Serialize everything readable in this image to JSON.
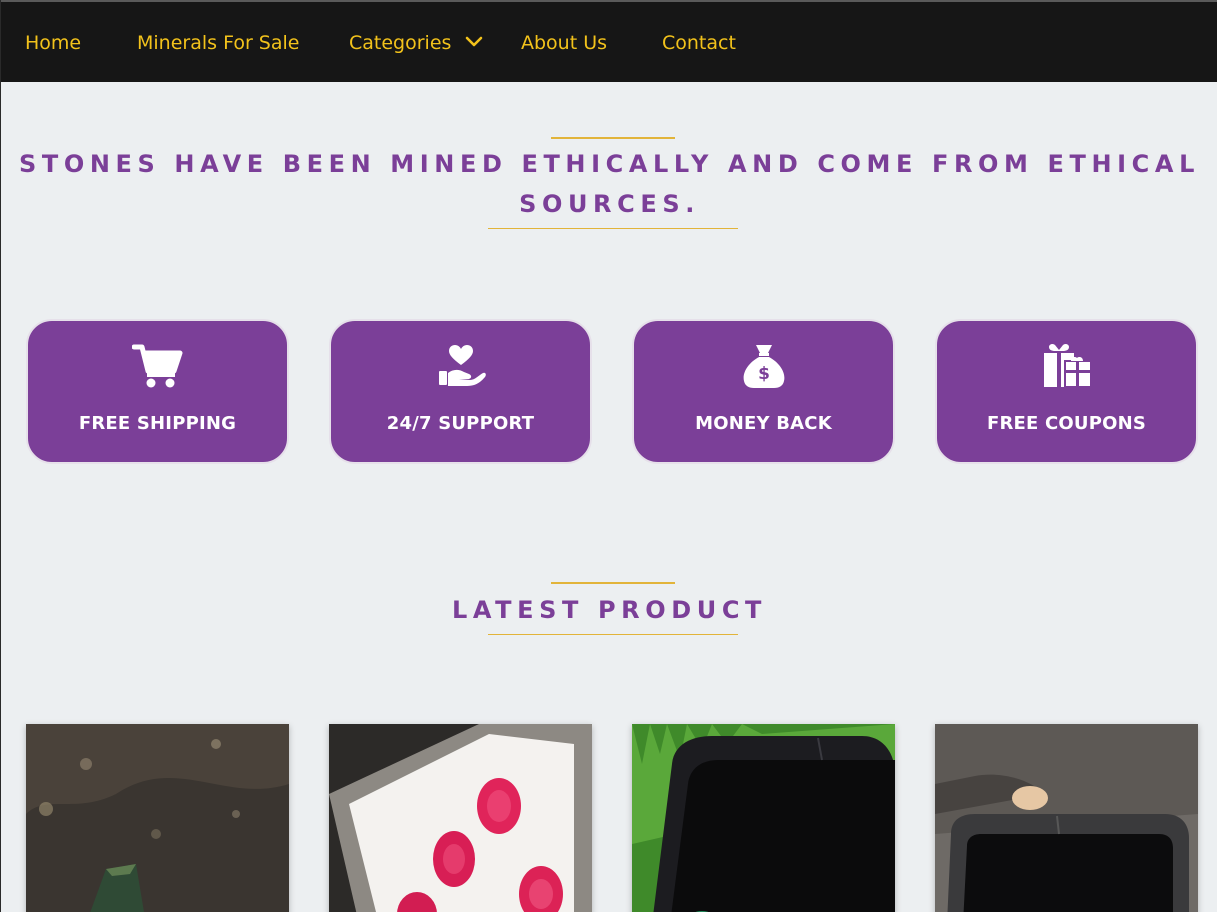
{
  "nav": {
    "items": [
      "Home",
      "Minerals For Sale",
      "Categories",
      "About Us",
      "Contact"
    ]
  },
  "intro": {
    "heading_line1": "STONES HAVE BEEN MINED ETHICALLY AND COME FROM ETHICAL",
    "heading_line2": "SOURCES."
  },
  "features": [
    {
      "label": "FREE SHIPPING",
      "icon": "cart-icon"
    },
    {
      "label": "24/7 SUPPORT",
      "icon": "hand-heart-icon"
    },
    {
      "label": "MONEY BACK",
      "icon": "money-bag-icon"
    },
    {
      "label": "FREE COUPONS",
      "icon": "gift-icon"
    }
  ],
  "latest": {
    "heading": "LATEST PRODUCT"
  },
  "colors": {
    "nav_bg": "#161616",
    "nav_text": "#f2c21b",
    "accent_purple": "#7b3f98",
    "rule_gold": "#e2b43a",
    "page_bg": "#eceff1"
  }
}
